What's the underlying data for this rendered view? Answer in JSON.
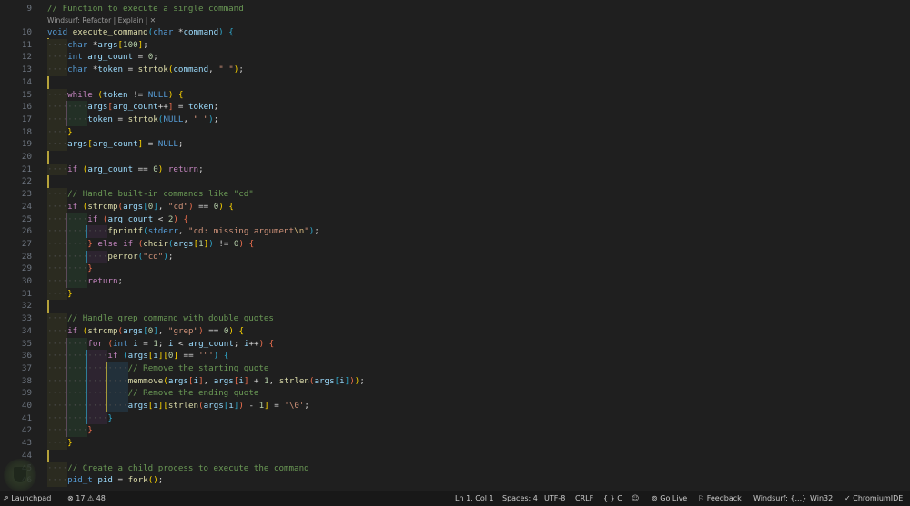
{
  "codelens": {
    "label": "Windsurf: Refactor | Explain | ",
    "close": "✕"
  },
  "lines": [
    {
      "n": "9",
      "lvl": 0,
      "t": [
        [
          "m",
          "// Function to execute a single command"
        ]
      ]
    },
    {
      "n": "10",
      "lvl": 0,
      "t": [
        [
          "k",
          "void"
        ],
        [
          "p",
          " "
        ],
        [
          "f",
          "execute_command"
        ],
        [
          "b3",
          "("
        ],
        [
          "k",
          "char"
        ],
        [
          "p",
          " *"
        ],
        [
          "v",
          "command"
        ],
        [
          "b3",
          ")"
        ],
        [
          "p",
          " "
        ],
        [
          "b3",
          "{"
        ]
      ]
    },
    {
      "n": "11",
      "lvl": 1,
      "t": [
        [
          "k",
          "char"
        ],
        [
          "p",
          " *"
        ],
        [
          "v",
          "args"
        ],
        [
          "b1",
          "["
        ],
        [
          "n",
          "100"
        ],
        [
          "b1",
          "]"
        ],
        [
          "p",
          ";"
        ]
      ]
    },
    {
      "n": "12",
      "lvl": 1,
      "t": [
        [
          "k",
          "int"
        ],
        [
          "p",
          " "
        ],
        [
          "v",
          "arg_count"
        ],
        [
          "p",
          " = "
        ],
        [
          "n",
          "0"
        ],
        [
          "p",
          ";"
        ]
      ]
    },
    {
      "n": "13",
      "lvl": 1,
      "t": [
        [
          "k",
          "char"
        ],
        [
          "p",
          " *"
        ],
        [
          "v",
          "token"
        ],
        [
          "p",
          " = "
        ],
        [
          "f",
          "strtok"
        ],
        [
          "b1",
          "("
        ],
        [
          "v",
          "command"
        ],
        [
          "p",
          ", "
        ],
        [
          "s",
          "\" \""
        ],
        [
          "b1",
          ")"
        ],
        [
          "p",
          ";"
        ]
      ]
    },
    {
      "n": "14",
      "lvl": 0,
      "t": []
    },
    {
      "n": "15",
      "lvl": 1,
      "t": [
        [
          "c",
          "while"
        ],
        [
          "p",
          " "
        ],
        [
          "b1",
          "("
        ],
        [
          "v",
          "token"
        ],
        [
          "p",
          " != "
        ],
        [
          "k",
          "NULL"
        ],
        [
          "b1",
          ")"
        ],
        [
          "p",
          " "
        ],
        [
          "b1",
          "{"
        ]
      ]
    },
    {
      "n": "16",
      "lvl": 2,
      "t": [
        [
          "v",
          "args"
        ],
        [
          "b2",
          "["
        ],
        [
          "v",
          "arg_count"
        ],
        [
          "p",
          "++"
        ],
        [
          "b2",
          "]"
        ],
        [
          "p",
          " = "
        ],
        [
          "v",
          "token"
        ],
        [
          "p",
          ";"
        ]
      ]
    },
    {
      "n": "17",
      "lvl": 2,
      "t": [
        [
          "v",
          "token"
        ],
        [
          "p",
          " = "
        ],
        [
          "f",
          "strtok"
        ],
        [
          "b3",
          "("
        ],
        [
          "k",
          "NULL"
        ],
        [
          "p",
          ", "
        ],
        [
          "s",
          "\" \""
        ],
        [
          "b3",
          ")"
        ],
        [
          "p",
          ";"
        ]
      ]
    },
    {
      "n": "18",
      "lvl": 1,
      "t": [
        [
          "b1",
          "}"
        ]
      ]
    },
    {
      "n": "19",
      "lvl": 1,
      "t": [
        [
          "v",
          "args"
        ],
        [
          "b1",
          "["
        ],
        [
          "v",
          "arg_count"
        ],
        [
          "b1",
          "]"
        ],
        [
          "p",
          " = "
        ],
        [
          "k",
          "NULL"
        ],
        [
          "p",
          ";"
        ]
      ]
    },
    {
      "n": "20",
      "lvl": 0,
      "t": []
    },
    {
      "n": "21",
      "lvl": 1,
      "t": [
        [
          "c",
          "if"
        ],
        [
          "p",
          " "
        ],
        [
          "b1",
          "("
        ],
        [
          "v",
          "arg_count"
        ],
        [
          "p",
          " == "
        ],
        [
          "n",
          "0"
        ],
        [
          "b1",
          ")"
        ],
        [
          "p",
          " "
        ],
        [
          "c",
          "return"
        ],
        [
          "p",
          ";"
        ]
      ]
    },
    {
      "n": "22",
      "lvl": 0,
      "t": []
    },
    {
      "n": "23",
      "lvl": 1,
      "t": [
        [
          "m",
          "// Handle built-in commands like \"cd\""
        ]
      ]
    },
    {
      "n": "24",
      "lvl": 1,
      "t": [
        [
          "c",
          "if"
        ],
        [
          "p",
          " "
        ],
        [
          "b1",
          "("
        ],
        [
          "f",
          "strcmp"
        ],
        [
          "b2",
          "("
        ],
        [
          "v",
          "args"
        ],
        [
          "b3",
          "["
        ],
        [
          "n",
          "0"
        ],
        [
          "b3",
          "]"
        ],
        [
          "p",
          ", "
        ],
        [
          "s",
          "\"cd\""
        ],
        [
          "b2",
          ")"
        ],
        [
          "p",
          " == "
        ],
        [
          "n",
          "0"
        ],
        [
          "b1",
          ")"
        ],
        [
          "p",
          " "
        ],
        [
          "b1",
          "{"
        ]
      ]
    },
    {
      "n": "25",
      "lvl": 2,
      "t": [
        [
          "c",
          "if"
        ],
        [
          "p",
          " "
        ],
        [
          "b2",
          "("
        ],
        [
          "v",
          "arg_count"
        ],
        [
          "p",
          " < "
        ],
        [
          "n",
          "2"
        ],
        [
          "b2",
          ")"
        ],
        [
          "p",
          " "
        ],
        [
          "b2",
          "{"
        ]
      ]
    },
    {
      "n": "26",
      "lvl": 3,
      "t": [
        [
          "f",
          "fprintf"
        ],
        [
          "b3",
          "("
        ],
        [
          "k",
          "stderr"
        ],
        [
          "p",
          ", "
        ],
        [
          "s",
          "\"cd: missing argument"
        ],
        [
          "e",
          "\\n"
        ],
        [
          "s",
          "\""
        ],
        [
          "b3",
          ")"
        ],
        [
          "p",
          ";"
        ]
      ]
    },
    {
      "n": "27",
      "lvl": 2,
      "t": [
        [
          "b2",
          "}"
        ],
        [
          "p",
          " "
        ],
        [
          "c",
          "else"
        ],
        [
          "p",
          " "
        ],
        [
          "c",
          "if"
        ],
        [
          "p",
          " "
        ],
        [
          "b2",
          "("
        ],
        [
          "f",
          "chdir"
        ],
        [
          "b3",
          "("
        ],
        [
          "v",
          "args"
        ],
        [
          "b1",
          "["
        ],
        [
          "n",
          "1"
        ],
        [
          "b1",
          "]"
        ],
        [
          "b3",
          ")"
        ],
        [
          "p",
          " != "
        ],
        [
          "n",
          "0"
        ],
        [
          "b2",
          ")"
        ],
        [
          "p",
          " "
        ],
        [
          "b2",
          "{"
        ]
      ]
    },
    {
      "n": "28",
      "lvl": 3,
      "t": [
        [
          "f",
          "perror"
        ],
        [
          "b3",
          "("
        ],
        [
          "s",
          "\"cd\""
        ],
        [
          "b3",
          ")"
        ],
        [
          "p",
          ";"
        ]
      ]
    },
    {
      "n": "29",
      "lvl": 2,
      "t": [
        [
          "b2",
          "}"
        ]
      ]
    },
    {
      "n": "30",
      "lvl": 2,
      "t": [
        [
          "c",
          "return"
        ],
        [
          "p",
          ";"
        ]
      ]
    },
    {
      "n": "31",
      "lvl": 1,
      "t": [
        [
          "b1",
          "}"
        ]
      ]
    },
    {
      "n": "32",
      "lvl": 0,
      "t": []
    },
    {
      "n": "33",
      "lvl": 1,
      "t": [
        [
          "m",
          "// Handle grep command with double quotes"
        ]
      ]
    },
    {
      "n": "34",
      "lvl": 1,
      "t": [
        [
          "c",
          "if"
        ],
        [
          "p",
          " "
        ],
        [
          "b1",
          "("
        ],
        [
          "f",
          "strcmp"
        ],
        [
          "b2",
          "("
        ],
        [
          "v",
          "args"
        ],
        [
          "b3",
          "["
        ],
        [
          "n",
          "0"
        ],
        [
          "b3",
          "]"
        ],
        [
          "p",
          ", "
        ],
        [
          "s",
          "\"grep\""
        ],
        [
          "b2",
          ")"
        ],
        [
          "p",
          " == "
        ],
        [
          "n",
          "0"
        ],
        [
          "b1",
          ")"
        ],
        [
          "p",
          " "
        ],
        [
          "b1",
          "{"
        ]
      ]
    },
    {
      "n": "35",
      "lvl": 2,
      "t": [
        [
          "c",
          "for"
        ],
        [
          "p",
          " "
        ],
        [
          "b2",
          "("
        ],
        [
          "k",
          "int"
        ],
        [
          "p",
          " "
        ],
        [
          "v",
          "i"
        ],
        [
          "p",
          " = "
        ],
        [
          "n",
          "1"
        ],
        [
          "p",
          "; "
        ],
        [
          "v",
          "i"
        ],
        [
          "p",
          " < "
        ],
        [
          "v",
          "arg_count"
        ],
        [
          "p",
          "; "
        ],
        [
          "v",
          "i"
        ],
        [
          "p",
          "++"
        ],
        [
          "b2",
          ")"
        ],
        [
          "p",
          " "
        ],
        [
          "b2",
          "{"
        ]
      ]
    },
    {
      "n": "36",
      "lvl": 3,
      "t": [
        [
          "c",
          "if"
        ],
        [
          "p",
          " "
        ],
        [
          "b3",
          "("
        ],
        [
          "v",
          "args"
        ],
        [
          "b1",
          "["
        ],
        [
          "v",
          "i"
        ],
        [
          "b1",
          "]"
        ],
        [
          "b1",
          "["
        ],
        [
          "n",
          "0"
        ],
        [
          "b1",
          "]"
        ],
        [
          "p",
          " == "
        ],
        [
          "s",
          "'\"'"
        ],
        [
          "b3",
          ")"
        ],
        [
          "p",
          " "
        ],
        [
          "b3",
          "{"
        ]
      ]
    },
    {
      "n": "37",
      "lvl": 4,
      "t": [
        [
          "m",
          "// Remove the starting quote"
        ]
      ]
    },
    {
      "n": "38",
      "lvl": 4,
      "t": [
        [
          "f",
          "memmove"
        ],
        [
          "b1",
          "("
        ],
        [
          "v",
          "args"
        ],
        [
          "b2",
          "["
        ],
        [
          "v",
          "i"
        ],
        [
          "b2",
          "]"
        ],
        [
          "p",
          ", "
        ],
        [
          "v",
          "args"
        ],
        [
          "b2",
          "["
        ],
        [
          "v",
          "i"
        ],
        [
          "b2",
          "]"
        ],
        [
          "p",
          " + "
        ],
        [
          "n",
          "1"
        ],
        [
          "p",
          ", "
        ],
        [
          "f",
          "strlen"
        ],
        [
          "b2",
          "("
        ],
        [
          "v",
          "args"
        ],
        [
          "b3",
          "["
        ],
        [
          "v",
          "i"
        ],
        [
          "b3",
          "]"
        ],
        [
          "b2",
          ")"
        ],
        [
          "b1",
          ")"
        ],
        [
          "p",
          ";"
        ]
      ]
    },
    {
      "n": "39",
      "lvl": 4,
      "t": [
        [
          "m",
          "// Remove the ending quote"
        ]
      ]
    },
    {
      "n": "40",
      "lvl": 4,
      "t": [
        [
          "v",
          "args"
        ],
        [
          "b1",
          "["
        ],
        [
          "v",
          "i"
        ],
        [
          "b1",
          "]"
        ],
        [
          "b1",
          "["
        ],
        [
          "f",
          "strlen"
        ],
        [
          "b2",
          "("
        ],
        [
          "v",
          "args"
        ],
        [
          "b3",
          "["
        ],
        [
          "v",
          "i"
        ],
        [
          "b3",
          "]"
        ],
        [
          "b2",
          ")"
        ],
        [
          "p",
          " - "
        ],
        [
          "n",
          "1"
        ],
        [
          "b1",
          "]"
        ],
        [
          "p",
          " = "
        ],
        [
          "s",
          "'\\0'"
        ],
        [
          "p",
          ";"
        ]
      ]
    },
    {
      "n": "41",
      "lvl": 3,
      "t": [
        [
          "b3",
          "}"
        ]
      ]
    },
    {
      "n": "42",
      "lvl": 2,
      "t": [
        [
          "b2",
          "}"
        ]
      ]
    },
    {
      "n": "43",
      "lvl": 1,
      "t": [
        [
          "b1",
          "}"
        ]
      ]
    },
    {
      "n": "44",
      "lvl": 0,
      "t": []
    },
    {
      "n": "45",
      "lvl": 1,
      "t": [
        [
          "m",
          "// Create a child process to execute the command"
        ]
      ]
    },
    {
      "n": "46",
      "lvl": 1,
      "t": [
        [
          "k",
          "pid_t"
        ],
        [
          "p",
          " "
        ],
        [
          "v",
          "pid"
        ],
        [
          "p",
          " = "
        ],
        [
          "f",
          "fork"
        ],
        [
          "b1",
          "()"
        ],
        [
          "p",
          ";"
        ]
      ]
    }
  ],
  "status": {
    "remote_icon": "remote-icon",
    "launchpad": "Launchpad",
    "errors": "17",
    "warnings": "48",
    "position": "Ln 1, Col 1",
    "spaces": "Spaces: 4",
    "encoding": "UTF-8",
    "eol": "CRLF",
    "language": "{ }  C",
    "go_live": "Go Live",
    "feedback": "Feedback",
    "windsurf": "Windsurf: {...}",
    "platform": "Win32",
    "chromium": "✓ ChromiumIDE"
  }
}
